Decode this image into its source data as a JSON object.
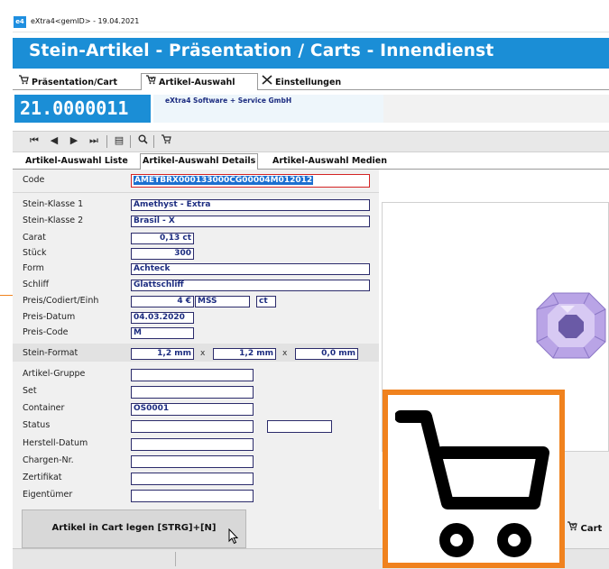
{
  "window": {
    "title": "eXtra4<gemID> - 19.04.2021",
    "app_icon": "xtra-app-icon"
  },
  "banner": {
    "title": "Stein-Artikel - Präsentation / Carts - Innendienst"
  },
  "top_tabs": [
    {
      "label": "Präsentation/Cart",
      "icon": "cart-icon"
    },
    {
      "label": "Artikel-Auswahl",
      "icon": "cart-check-icon",
      "active": true
    },
    {
      "label": "Einstellungen",
      "icon": "tools-icon"
    }
  ],
  "article": {
    "number": "21.0000011",
    "company": "eXtra4 Software + Service GmbH"
  },
  "toolbar": {
    "icons": [
      "first-icon",
      "prev-icon",
      "next-icon",
      "last-icon",
      "list-icon",
      "search-icon",
      "cart-icon"
    ]
  },
  "sub_tabs": [
    {
      "label": "Artikel-Auswahl Liste"
    },
    {
      "label": "Artikel-Auswahl Details",
      "active": true
    },
    {
      "label": "Artikel-Auswahl Medien"
    }
  ],
  "form": {
    "code": {
      "label": "Code",
      "value": "AMETBRX000133000CG00004M012012"
    },
    "stein_klasse_1": {
      "label": "Stein-Klasse 1",
      "value": "Amethyst - Extra"
    },
    "stein_klasse_2": {
      "label": "Stein-Klasse 2",
      "value": "Brasil - X"
    },
    "carat": {
      "label": "Carat",
      "value": "0,13 ct"
    },
    "stueck": {
      "label": "Stück",
      "value": "300"
    },
    "form": {
      "label": "Form",
      "value": "Achteck"
    },
    "schliff": {
      "label": "Schliff",
      "value": "Glattschliff"
    },
    "preis": {
      "label": "Preis/Codiert/Einh",
      "value": "4 €",
      "code": "MSS",
      "unit": "ct"
    },
    "preis_datum": {
      "label": "Preis-Datum",
      "value": "04.03.2020"
    },
    "preis_code": {
      "label": "Preis-Code",
      "value": "M"
    },
    "stein_format": {
      "label": "Stein-Format",
      "a": "1,2 mm",
      "b": "1,2 mm",
      "c": "0,0 mm",
      "sep": "x"
    },
    "artikel_gruppe": {
      "label": "Artikel-Gruppe",
      "value": ""
    },
    "set": {
      "label": "Set",
      "value": ""
    },
    "container": {
      "label": "Container",
      "value": "OS0001"
    },
    "status": {
      "label": "Status",
      "value": ""
    },
    "herstell_datum": {
      "label": "Herstell-Datum",
      "value": ""
    },
    "chargen_nr": {
      "label": "Chargen-Nr.",
      "value": ""
    },
    "zertifikat": {
      "label": "Zertifikat",
      "value": ""
    },
    "eigentuemer": {
      "label": "Eigentümer",
      "value": ""
    }
  },
  "buttons": {
    "add_to_cart": "Artikel in Cart legen [STRG]+[N]",
    "cart": "Cart"
  },
  "colors": {
    "banner": "#1b8ed6",
    "field_text": "#1c2c80",
    "overlay_border": "#f0821e",
    "stone": "#b9a4e6"
  }
}
